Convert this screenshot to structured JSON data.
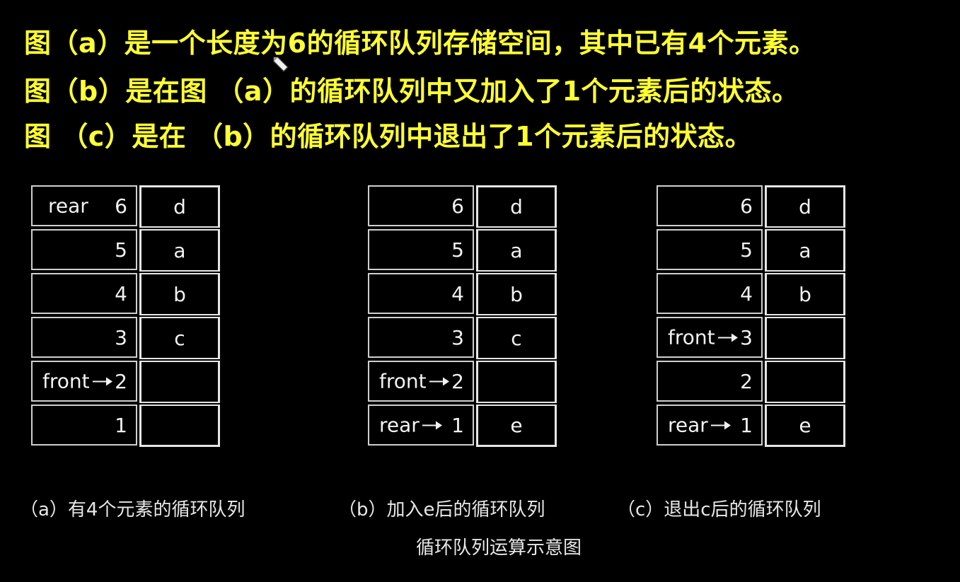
{
  "headlines": [
    "图（a）是一个长度为6的循环队列存储空间，其中已有4个元素。",
    "图（b）是在图 （a）的循环队列中又加入了1个元素后的状态。",
    "图 （c）是在 （b）的循环队列中退出了1个元素后的状态。"
  ],
  "diagrams": [
    {
      "rows": [
        {
          "index": "6",
          "value": "d",
          "pointer": "rear",
          "pointer_style": "plain"
        },
        {
          "index": "5",
          "value": "a",
          "pointer": ""
        },
        {
          "index": "4",
          "value": "b",
          "pointer": ""
        },
        {
          "index": "3",
          "value": "c",
          "pointer": ""
        },
        {
          "index": "2",
          "value": "",
          "pointer": "front",
          "pointer_style": "arrow"
        },
        {
          "index": "1",
          "value": "",
          "pointer": ""
        }
      ]
    },
    {
      "rows": [
        {
          "index": "6",
          "value": "d",
          "pointer": ""
        },
        {
          "index": "5",
          "value": "a",
          "pointer": ""
        },
        {
          "index": "4",
          "value": "b",
          "pointer": ""
        },
        {
          "index": "3",
          "value": "c",
          "pointer": ""
        },
        {
          "index": "2",
          "value": "",
          "pointer": "front",
          "pointer_style": "arrow"
        },
        {
          "index": "1",
          "value": "e",
          "pointer": "rear",
          "pointer_style": "arrow"
        }
      ]
    },
    {
      "rows": [
        {
          "index": "6",
          "value": "d",
          "pointer": ""
        },
        {
          "index": "5",
          "value": "a",
          "pointer": ""
        },
        {
          "index": "4",
          "value": "b",
          "pointer": ""
        },
        {
          "index": "3",
          "value": "",
          "pointer": "front",
          "pointer_style": "arrow"
        },
        {
          "index": "2",
          "value": "",
          "pointer": ""
        },
        {
          "index": "1",
          "value": "e",
          "pointer": "rear",
          "pointer_style": "arrow"
        }
      ]
    }
  ],
  "captions": [
    "（a）有4个元素的循环队列",
    "（b）加入e后的循环队列",
    "（c）退出c后的循环队列"
  ],
  "figure_title": "循环队列运算示意图",
  "colors": {
    "headline": "#ffff33",
    "background": "#000000",
    "cell_border": "#e6e6e6",
    "text": "#f2f2f2"
  },
  "icons": {
    "cursor": "pencil-cursor-icon"
  }
}
